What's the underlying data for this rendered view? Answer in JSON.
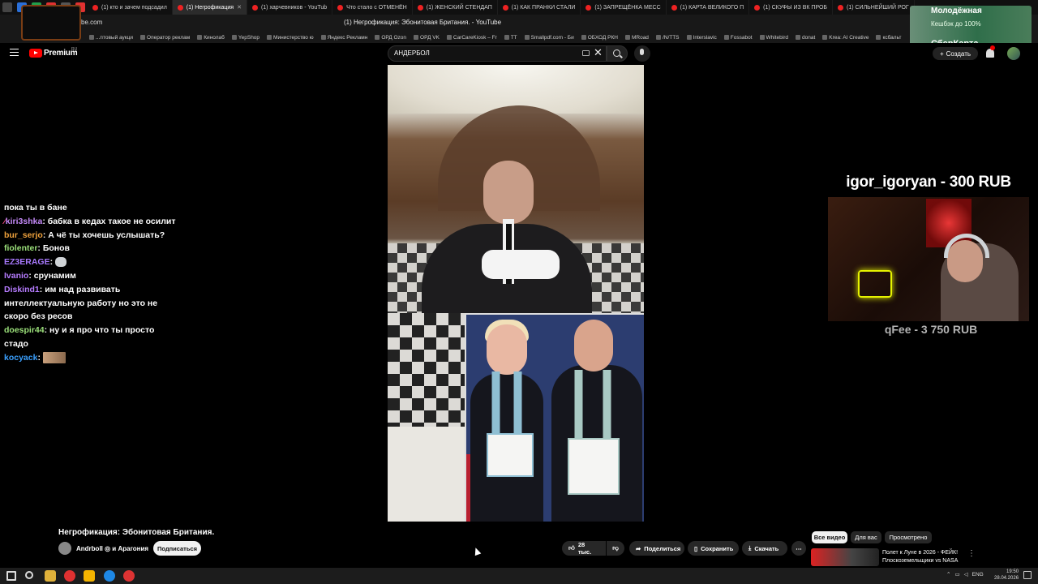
{
  "browser": {
    "tabs": [
      {
        "label": "(1) кто и зачем подсадил",
        "active": false
      },
      {
        "label": "(1) Негрофикация",
        "active": true
      },
      {
        "label": "(1) харчевников - YouTub",
        "active": false
      },
      {
        "label": "Что стало с ОТМЕНЁН",
        "active": false
      },
      {
        "label": "(1) ЖЕНСКИЙ СТЕНДАП",
        "active": false
      },
      {
        "label": "(1) КАК ПРАНКИ СТАЛИ",
        "active": false
      },
      {
        "label": "(1) ЗАПРЕЩЁНКА МЕСС",
        "active": false
      },
      {
        "label": "(1) КАРТА ВЕЛИКОГО П",
        "active": false
      },
      {
        "label": "(1) СКУФЫ ИЗ ВК ПРОБ",
        "active": false
      },
      {
        "label": "(1) СИЛЬНЕЙШИЙ РОГ",
        "active": false
      }
    ],
    "url": "be.com",
    "page_title": "(1) Негрофикация: Эбонитовая Британия. - YouTube",
    "bookmarks": [
      "...птовый аукци",
      "Оператор реклам",
      "Кинолаб",
      "YepShop",
      "Министерство ю",
      "Яндекс Рекламн",
      "ОРД Ozon",
      "ОРД VK",
      "CarCareKiosk – Fr",
      "TT",
      "Smallpdf.com - Би",
      "ОБХОД РКН",
      "MRoad",
      "/N/TTS",
      "Interslavic",
      "Fossabot",
      "Whitebird",
      "donat",
      "Krea: AI Creative",
      "ксбальт"
    ]
  },
  "ad": {
    "line1": "Молодёжная",
    "line2": "Кешбэк до 100%",
    "line3": "СберКарта"
  },
  "youtube": {
    "logo_text": "Premium",
    "logo_sup": "RU",
    "search_value": "АНДЕРБОЛ",
    "clear_glyph": "✕",
    "create_label": "Создать",
    "create_glyph": "+"
  },
  "chat": [
    {
      "user": "",
      "user_color": "#ffffff",
      "text": "пока ты в бане"
    },
    {
      "user": "kiri3shka",
      "user_color": "#c58af9",
      "text": "бабка в кедах такое не осилит",
      "badge": true
    },
    {
      "user": "bur_serjo",
      "user_color": "#f0a23c",
      "text": "А чё ты хочешь услышать?"
    },
    {
      "user": "fiolenter",
      "user_color": "#9be07a",
      "text": "Бонов"
    },
    {
      "user": "EZ3ERAGE",
      "user_color": "#a97aff",
      "text": "",
      "emote": "ghost"
    },
    {
      "user": "Ivanio",
      "user_color": "#b67cff",
      "text": "срунамим"
    },
    {
      "user": "Diskind1",
      "user_color": "#b67cff",
      "text": "им над развивать интеллектуальную работу но это не скоро без ресов"
    },
    {
      "user": "doespir44",
      "user_color": "#9be07a",
      "text": "ну и я про что ты просто стадо"
    },
    {
      "user": "kocyack",
      "user_color": "#3aa0ff",
      "text": "",
      "emote": "image"
    }
  ],
  "donations": {
    "top": "igor_igoryan - 300 RUB",
    "bottom": "qFee - 3 750 RUB"
  },
  "video": {
    "title": "Негрофикация: Эбонитовая Британия.",
    "channel": "Andrboll ◎ и Арагония",
    "subscribe_label": "Подписаться",
    "likes": "28 тыс.",
    "share_label": "Поделиться",
    "save_label": "Сохранить",
    "download_label": "Скачать",
    "more_glyph": "⋯"
  },
  "filters": [
    "Все видео",
    "Для вас",
    "Просмотрено"
  ],
  "recommendation": {
    "title": "Полет к Луне в 2026 - ФЕЙК! Плоскоземельщики vs NASA",
    "more_glyph": "⋮"
  },
  "taskbar": {
    "lang": "ENG",
    "time": "19:50",
    "date": "28.04.2026"
  },
  "colors": {
    "youtube_red": "#ff0000",
    "background": "#000000",
    "chip_active": "#f1f1f1"
  }
}
